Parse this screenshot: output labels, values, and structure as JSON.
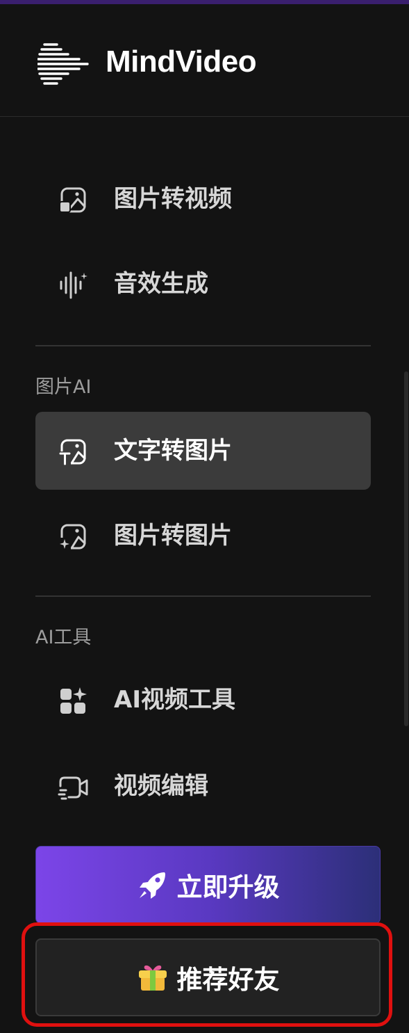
{
  "app": {
    "name": "MindVideo"
  },
  "nav_top": [
    {
      "label": "图片转视频",
      "icon": "image-to-video-icon"
    },
    {
      "label": "音效生成",
      "icon": "audio-waveform-icon"
    }
  ],
  "section_image_ai": {
    "title": "图片AI",
    "items": [
      {
        "label": "文字转图片",
        "icon": "text-to-image-icon",
        "active": true
      },
      {
        "label": "图片转图片",
        "icon": "image-to-image-icon",
        "active": false
      }
    ]
  },
  "section_ai_tools": {
    "title": "AI工具",
    "items": [
      {
        "label": "AI视频工具",
        "icon": "apps-grid-sparkle-icon"
      },
      {
        "label": "视频编辑",
        "icon": "video-edit-icon"
      }
    ]
  },
  "upgrade_button": {
    "label": "立即升级",
    "icon": "rocket-icon"
  },
  "referral_button": {
    "label": "推荐好友",
    "icon": "gift-icon"
  },
  "colors": {
    "sidebar_bg": "#131313",
    "active_item_bg": "#3b3b3b",
    "upgrade_gradient_start": "#7c45e8",
    "upgrade_gradient_end": "#2c2f78",
    "highlight_outline": "#e0100f"
  }
}
